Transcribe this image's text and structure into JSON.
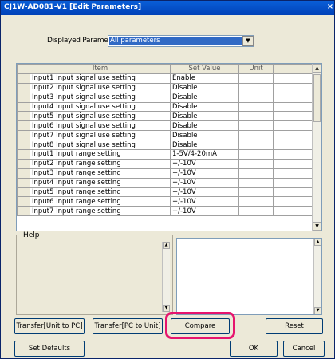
{
  "window": {
    "title": "CJ1W-AD081-V1 [Edit Parameters]",
    "close_glyph": "×"
  },
  "displayed_parameter": {
    "label": "Displayed Parameter",
    "selected": "All parameters"
  },
  "grid": {
    "columns": [
      "Item",
      "Set Value",
      "Unit"
    ],
    "rows": [
      {
        "item": "Input1 Input signal use setting",
        "value": "Enable",
        "unit": ""
      },
      {
        "item": "Input2 Input signal use setting",
        "value": "Disable",
        "unit": ""
      },
      {
        "item": "Input3 Input signal use setting",
        "value": "Disable",
        "unit": ""
      },
      {
        "item": "Input4 Input signal use setting",
        "value": "Disable",
        "unit": ""
      },
      {
        "item": "Input5 Input signal use setting",
        "value": "Disable",
        "unit": ""
      },
      {
        "item": "Input6 Input signal use setting",
        "value": "Disable",
        "unit": ""
      },
      {
        "item": "Input7 Input signal use setting",
        "value": "Disable",
        "unit": ""
      },
      {
        "item": "Input8 Input signal use setting",
        "value": "Disable",
        "unit": ""
      },
      {
        "item": "Input1 Input range setting",
        "value": "1-5V/4-20mA",
        "unit": ""
      },
      {
        "item": "Input2 Input range setting",
        "value": "+/-10V",
        "unit": ""
      },
      {
        "item": "Input3 Input range setting",
        "value": "+/-10V",
        "unit": ""
      },
      {
        "item": "Input4 Input range setting",
        "value": "+/-10V",
        "unit": ""
      },
      {
        "item": "Input5 Input range setting",
        "value": "+/-10V",
        "unit": ""
      },
      {
        "item": "Input6 Input range setting",
        "value": "+/-10V",
        "unit": ""
      },
      {
        "item": "Input7 Input range setting",
        "value": "+/-10V",
        "unit": ""
      }
    ]
  },
  "help": {
    "label": "Help"
  },
  "buttons": {
    "transfer_unit_to_pc": "Transfer[Unit to PC]",
    "transfer_pc_to_unit": "Transfer[PC to Unit]",
    "compare": "Compare",
    "reset": "Reset",
    "set_defaults": "Set Defaults",
    "ok": "OK",
    "cancel": "Cancel"
  },
  "colors": {
    "highlight": "#e6156e",
    "selection": "#316ac5"
  }
}
